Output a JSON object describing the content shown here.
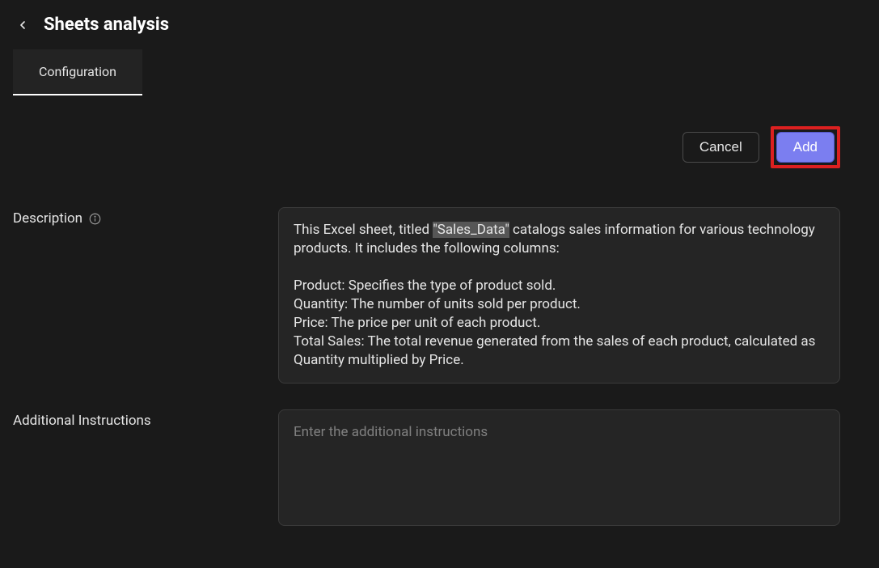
{
  "header": {
    "title": "Sheets analysis"
  },
  "tabs": {
    "active": "Configuration"
  },
  "buttons": {
    "cancel": "Cancel",
    "add": "Add"
  },
  "form": {
    "description": {
      "label": "Description",
      "intro": "This Excel sheet, titled ",
      "highlight": "\"Sales_Data\"",
      "afterHighlight": " catalogs sales information for various technology products. It includes the following columns:",
      "columns": "Product: Specifies the type of product sold.\nQuantity: The number of units sold per product.\nPrice: The price per unit of each product.\nTotal Sales: The total revenue generated from the sales of each product, calculated as Quantity multiplied by Price."
    },
    "additionalInstructions": {
      "label": "Additional Instructions",
      "placeholder": "Enter the additional instructions",
      "value": ""
    }
  }
}
